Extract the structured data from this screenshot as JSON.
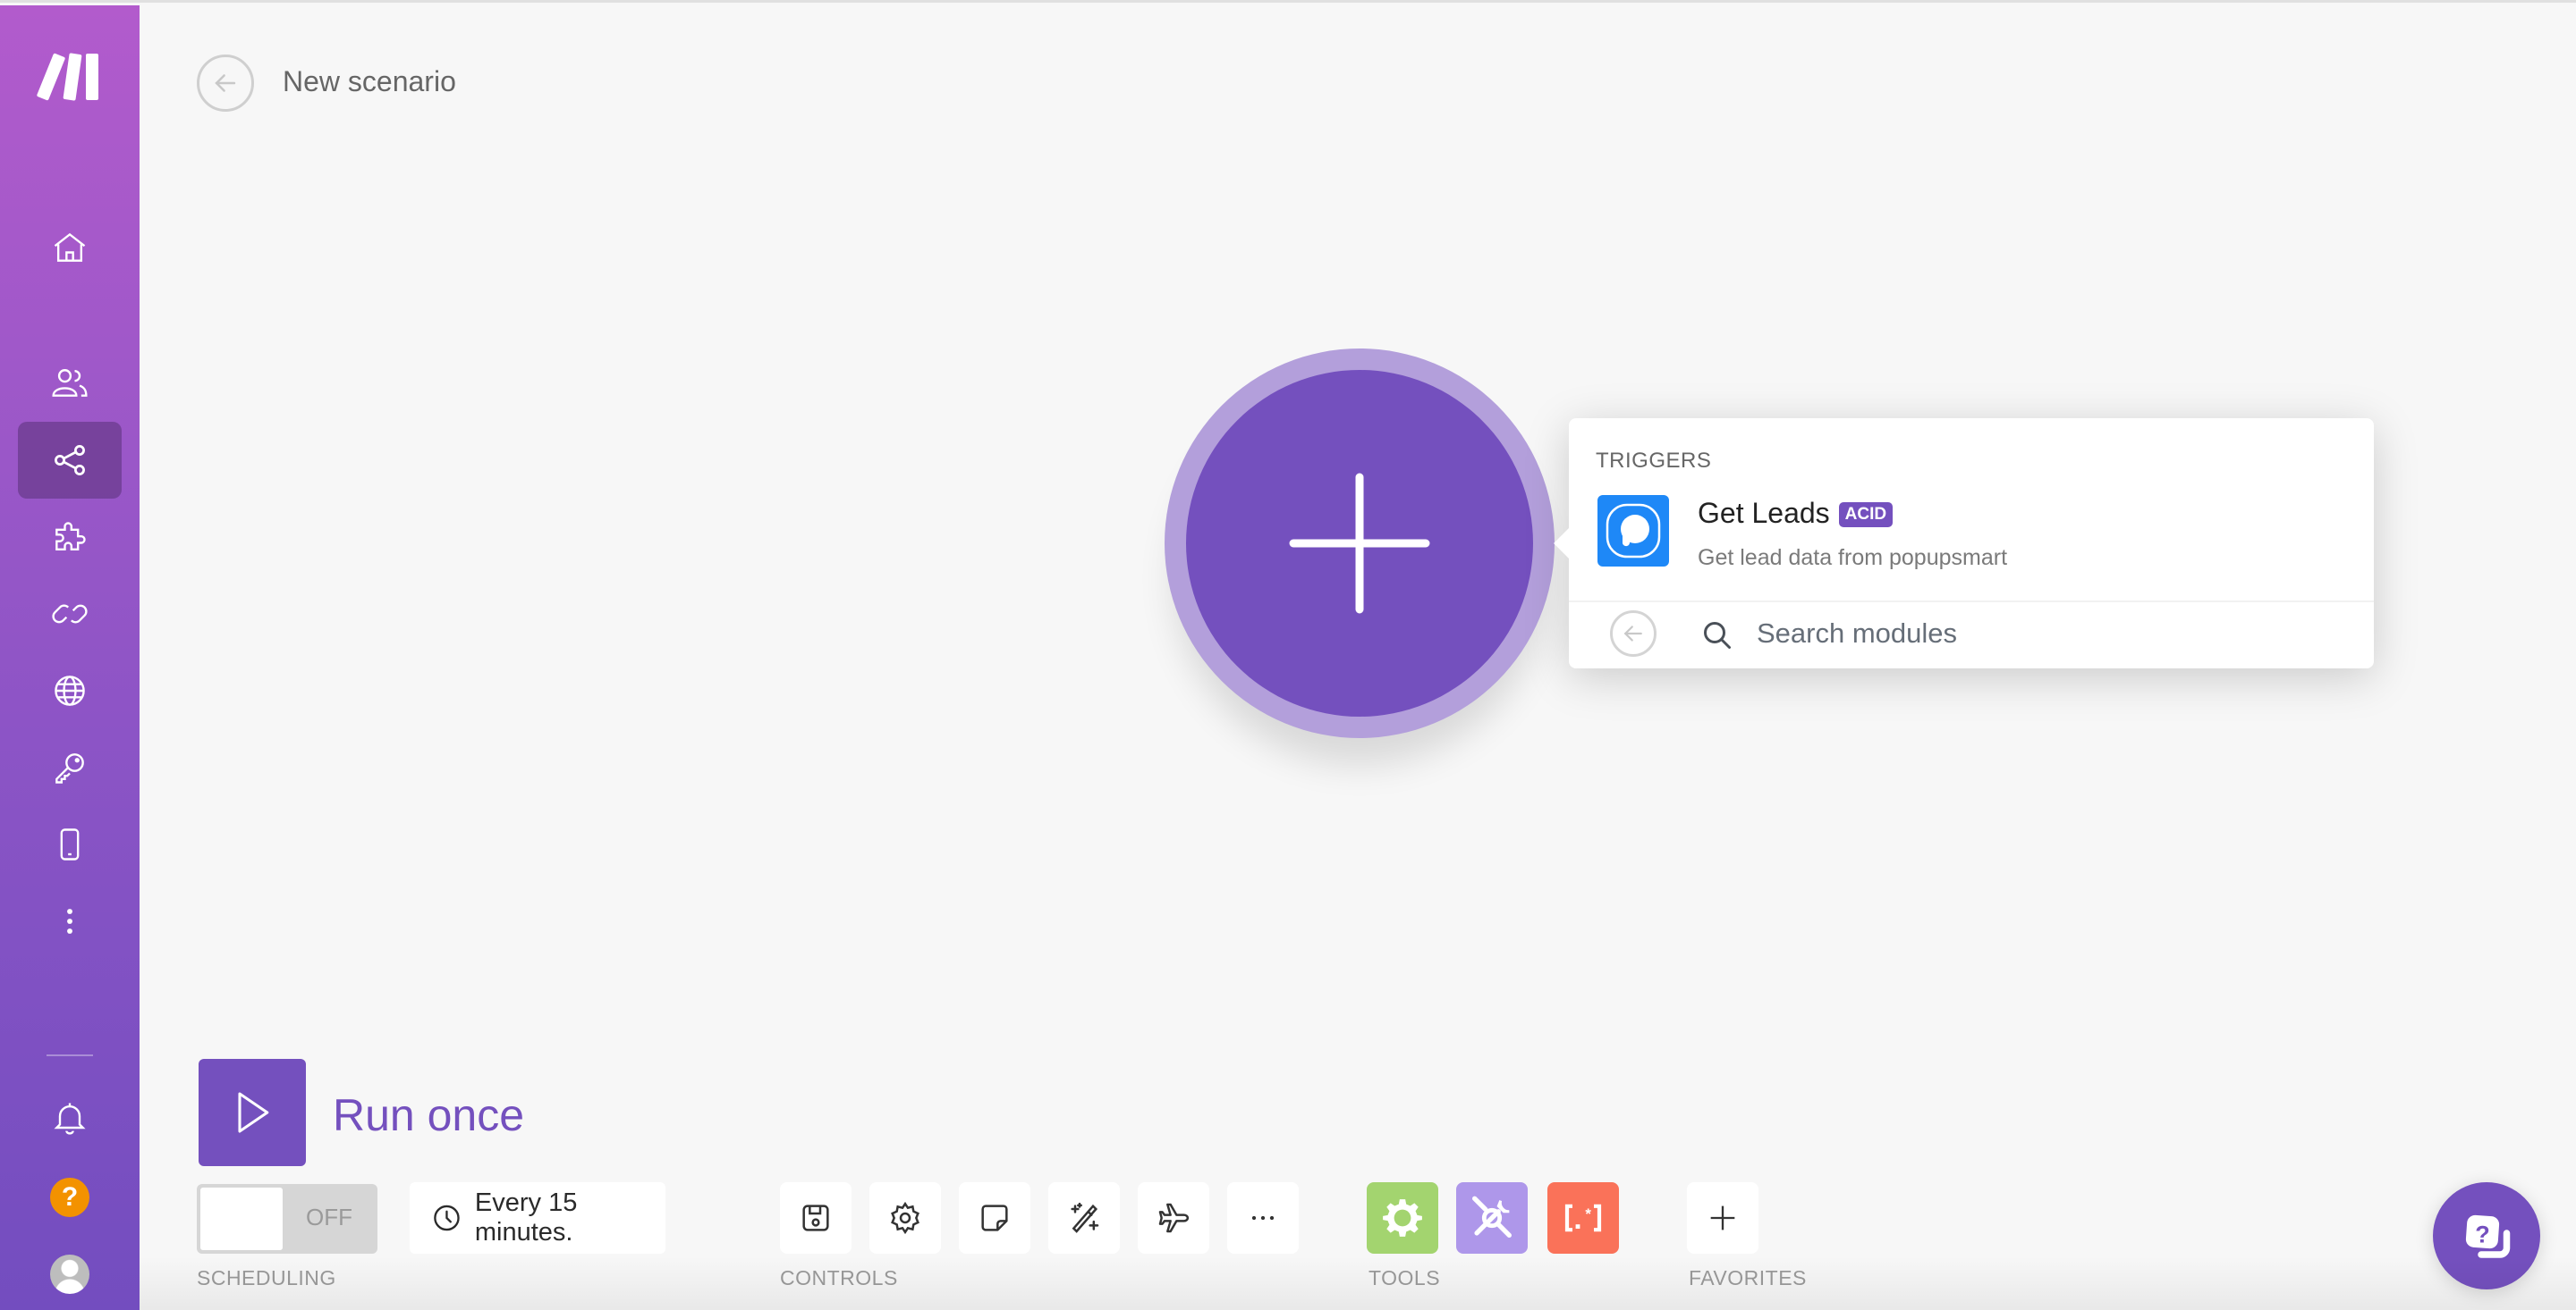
{
  "header": {
    "title": "New scenario"
  },
  "sidebar": {
    "items": [
      {
        "name": "home",
        "icon": "home-icon"
      },
      {
        "name": "team",
        "icon": "users-icon"
      },
      {
        "name": "scenarios",
        "icon": "share-icon",
        "active": true
      },
      {
        "name": "apps",
        "icon": "puzzle-icon"
      },
      {
        "name": "connections",
        "icon": "link-icon"
      },
      {
        "name": "webhooks",
        "icon": "globe-icon"
      },
      {
        "name": "keys",
        "icon": "key-icon"
      },
      {
        "name": "devices",
        "icon": "phone-icon"
      },
      {
        "name": "more",
        "icon": "more-vertical-icon"
      }
    ],
    "bottom": {
      "notifications_icon": "bell-icon",
      "help_label": "?",
      "avatar_icon": "user-avatar"
    }
  },
  "module_picker": {
    "section_title": "TRIGGERS",
    "modules": [
      {
        "name": "Get Leads",
        "badge": "ACID",
        "description": "Get lead data from popupsmart",
        "app_icon": "popupsmart-icon",
        "app_color": "#1e88f7"
      }
    ],
    "search_placeholder": "Search modules",
    "search_value": ""
  },
  "toolbar": {
    "run_once_label": "Run once",
    "scheduling": {
      "toggle_state": "OFF",
      "interval": "Every 15 minutes.",
      "label": "SCHEDULING"
    },
    "controls": {
      "label": "CONTROLS",
      "buttons": [
        "save-icon",
        "settings-icon",
        "notes-icon",
        "auto-align-icon",
        "explain-flow-icon",
        "more-icon"
      ]
    },
    "tools": {
      "label": "TOOLS",
      "buttons": [
        {
          "name": "flow-control",
          "color": "#a3d46f"
        },
        {
          "name": "tools",
          "color": "#ae97ea"
        },
        {
          "name": "text-parser",
          "color": "#fa7259"
        }
      ]
    },
    "favorites": {
      "label": "FAVORITES",
      "add_label": "+"
    }
  },
  "colors": {
    "brand": "#7450be",
    "sidebar_top": "#b25bcc",
    "sidebar_bottom": "#734dbf",
    "help_orange": "#f39200"
  }
}
